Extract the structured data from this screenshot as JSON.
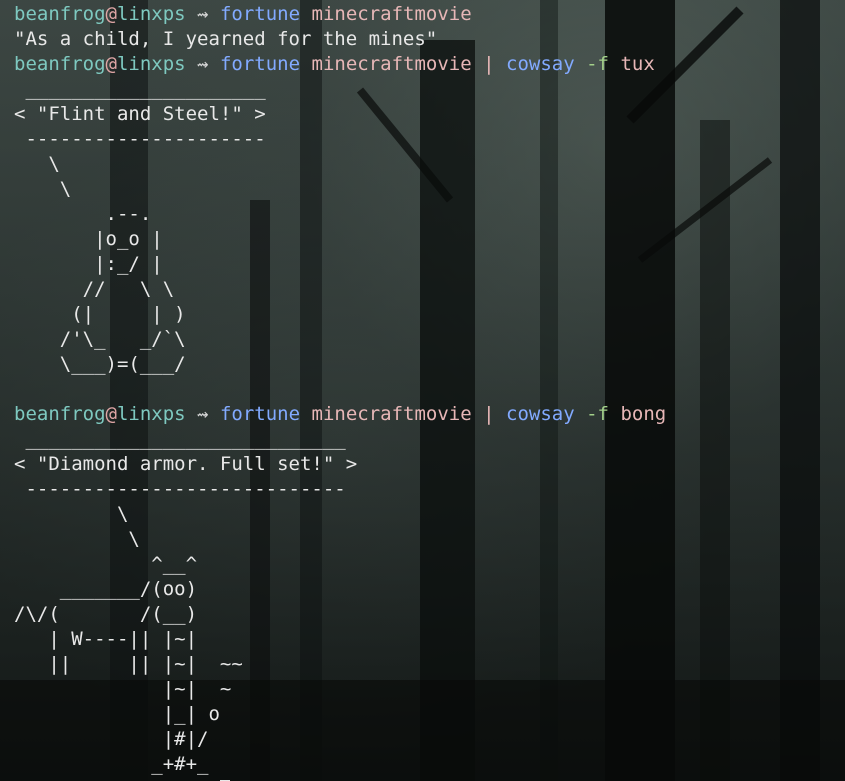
{
  "prompt": {
    "user": "beanfrog",
    "at": "@",
    "host": "linxps",
    "arrow": "⇝"
  },
  "commands": {
    "c1": {
      "cmd": "fortune",
      "arg": "minecraftmovie"
    },
    "c2": {
      "cmd": "fortune",
      "arg": "minecraftmovie",
      "pipe": "|",
      "cmd2": "cowsay",
      "flag": "-f",
      "flagarg": "tux"
    },
    "c3": {
      "cmd": "fortune",
      "arg": "minecraftmovie",
      "pipe": "|",
      "cmd2": "cowsay",
      "flag": "-f",
      "flagarg": "bong"
    }
  },
  "outputs": {
    "o1": "\"As a child, I yearned for the mines\"",
    "tux_bubble": [
      " _____________________",
      "< \"Flint and Steel!\" >",
      " ---------------------"
    ],
    "tux_art": [
      "   \\",
      "    \\",
      "        .--.",
      "       |o_o |",
      "       |:_/ |",
      "      //   \\ \\",
      "     (|     | )",
      "    /'\\_   _/`\\",
      "    \\___)=(___/"
    ],
    "bong_bubble": [
      " ____________________________",
      "< \"Diamond armor. Full set!\" >",
      " ----------------------------"
    ],
    "bong_art": [
      "         \\",
      "          \\",
      "            ^__^",
      "    _______/(oo)",
      "/\\/(       /(__)",
      "   | W----|| |~|",
      "   ||     || |~|  ~~",
      "             |~|  ~",
      "             |_| o",
      "             |#|/",
      "            _+#+_"
    ]
  }
}
